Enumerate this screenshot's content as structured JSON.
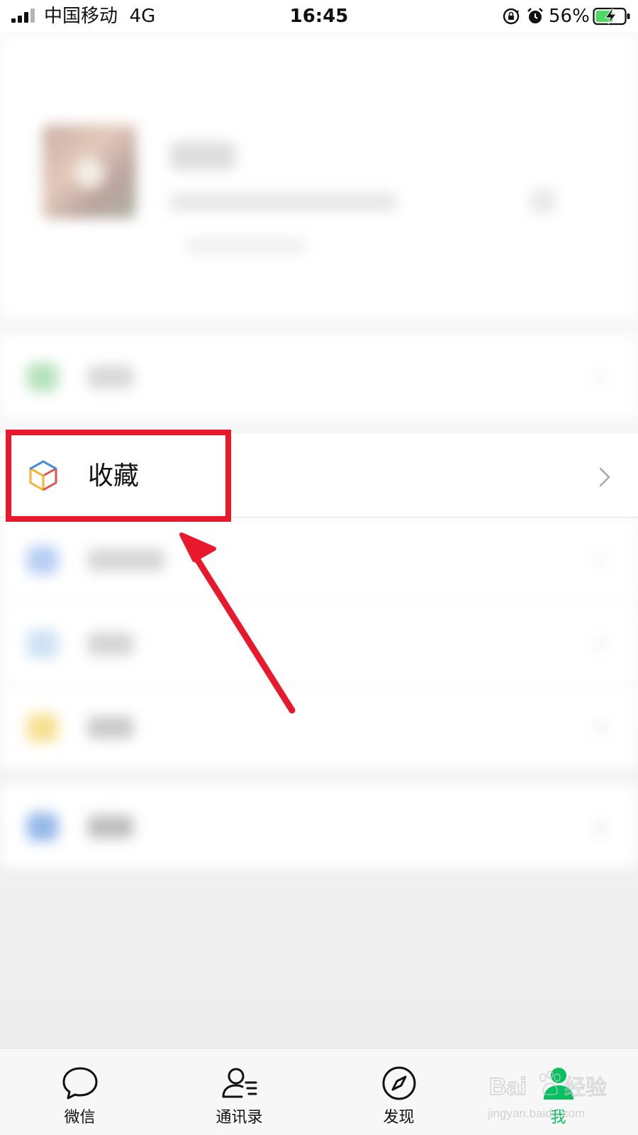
{
  "status_bar": {
    "carrier": "中国移动",
    "network": "4G",
    "time": "16:45",
    "battery_percent": "56%"
  },
  "favorites_row": {
    "label": "收藏",
    "icon": "favorites-cube-icon"
  },
  "annotation": {
    "highlight_color": "#e8192c",
    "arrow_color": "#e8192c"
  },
  "tab_bar": {
    "tabs": [
      {
        "label": "微信",
        "icon": "chat-bubble-icon",
        "active": false
      },
      {
        "label": "通讯录",
        "icon": "contacts-icon",
        "active": false
      },
      {
        "label": "发现",
        "icon": "compass-icon",
        "active": false
      },
      {
        "label": "我",
        "icon": "me-person-icon",
        "active": true
      }
    ],
    "active_color": "#07c160"
  },
  "watermark": {
    "brand": "Baidu",
    "brand_cn": "经验",
    "url": "jingyan.baidu.com"
  },
  "colors": {
    "accent_green": "#07c160",
    "annotation_red": "#e8192c"
  }
}
